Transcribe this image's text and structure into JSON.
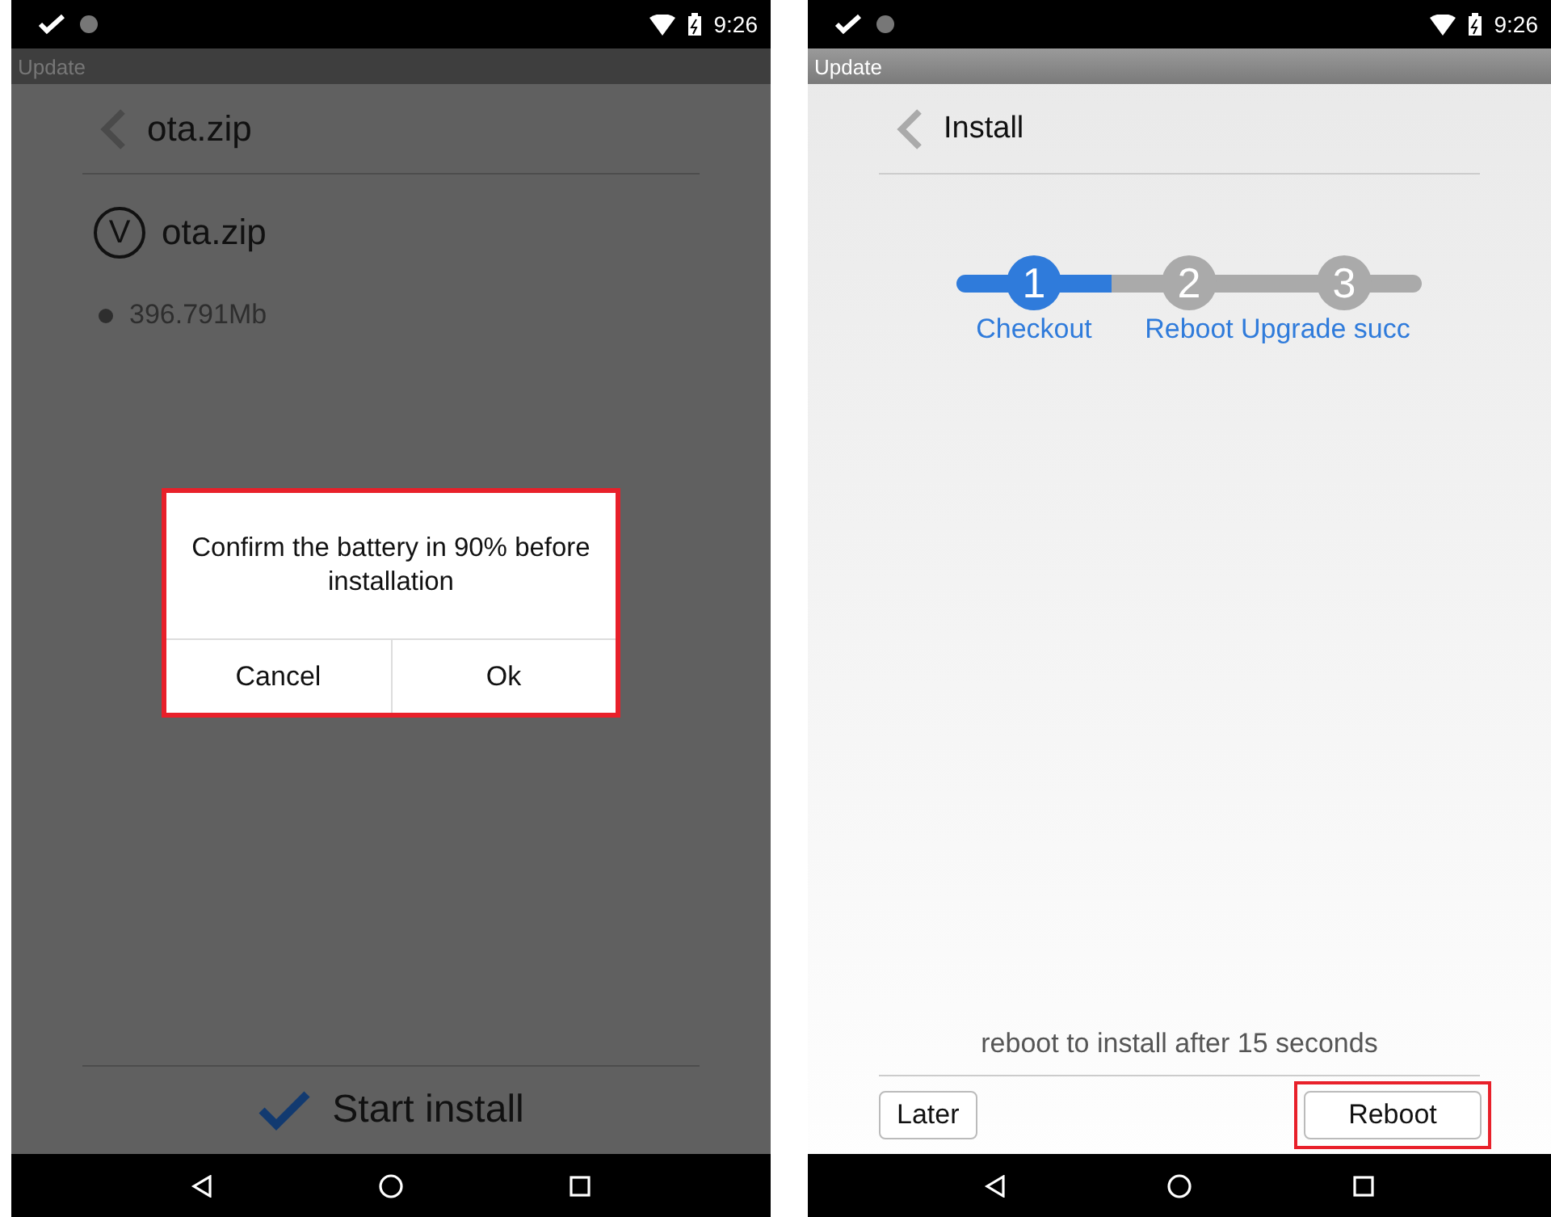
{
  "screens": [
    {
      "kind": "confirm",
      "status_bar": {
        "time": "9:26"
      },
      "app_title": "Update",
      "header": {
        "title": "ota.zip"
      },
      "file": {
        "badge": "V",
        "name": "ota.zip",
        "size": "396.791Mb"
      },
      "dialog": {
        "message": "Confirm the battery in 90% before installation",
        "buttons": [
          "Cancel",
          "Ok"
        ],
        "highlighted": true
      },
      "action": {
        "label": "Start install"
      }
    },
    {
      "kind": "install",
      "status_bar": {
        "time": "9:26"
      },
      "app_title": "Update",
      "header": {
        "title": "Install"
      },
      "steps": [
        {
          "number": "1",
          "label": "Checkout",
          "active": true
        },
        {
          "number": "2",
          "label": "Reboot",
          "active": false
        },
        {
          "number": "3",
          "label": "Upgrade succ",
          "active": false
        }
      ],
      "message": "reboot to install after 15 seconds",
      "buttons": [
        {
          "label": "Later",
          "highlighted": false
        },
        {
          "label": "Reboot",
          "highlighted": true
        }
      ]
    }
  ]
}
